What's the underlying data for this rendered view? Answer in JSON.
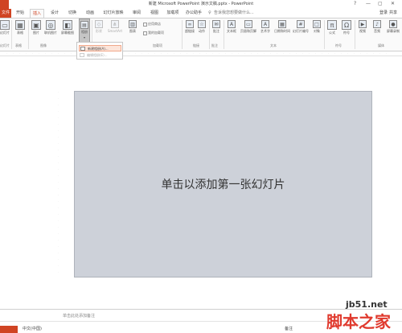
{
  "window": {
    "title": "新建 Microsoft PowerPoint 演示文稿.pptx - PowerPoint",
    "help": "?",
    "minimize": "—",
    "restore": "▢",
    "close": "✕"
  },
  "tabs": [
    {
      "label": "文件"
    },
    {
      "label": "开始"
    },
    {
      "label": "插入"
    },
    {
      "label": "设计"
    },
    {
      "label": "切换"
    },
    {
      "label": "动画"
    },
    {
      "label": "幻灯片放映"
    },
    {
      "label": "审阅"
    },
    {
      "label": "视图"
    },
    {
      "label": "加载项"
    },
    {
      "label": "办公助手"
    },
    {
      "label": "告诉我您想要做什么..."
    }
  ],
  "active_tab": "插入",
  "account": {
    "login": "登录",
    "share": "共享"
  },
  "ribbon": {
    "new_slide": "幻灯片",
    "table": "表格",
    "image": "图片",
    "online_image": "联机图片",
    "screenshot": "屏幕截图",
    "album": "相册",
    "new_slide_btn": "新建幻灯片",
    "shape": "形状",
    "smartart": "SmartArt",
    "chart": "图表",
    "app_store": "应用商店",
    "my_addins": "我的加载项",
    "hyperlink": "超链接",
    "action": "动作",
    "comment": "批注",
    "textbox": "文本框",
    "header_footer": "页眉和页脚",
    "wordart": "艺术字",
    "datetime": "日期和时间",
    "slide_number": "幻灯片编号",
    "object": "对象",
    "equation": "公式",
    "symbol": "符号",
    "video": "视频",
    "audio": "音频",
    "screen_record": "屏幕录制",
    "groups": {
      "slides": "幻灯片",
      "tables": "表格",
      "images": "图像",
      "addins": "加载项",
      "links": "链接",
      "comments": "批注",
      "text": "文本",
      "symbols": "符号",
      "media": "媒体"
    }
  },
  "dropdown": {
    "items": [
      {
        "label": "新建相册(A)..."
      },
      {
        "label": "编辑相册(E)..."
      }
    ]
  },
  "slide": {
    "placeholder": "单击以添加第一张幻灯片"
  },
  "notes": {
    "placeholder": "单击此处添加备注"
  },
  "status": {
    "language": "中文(中国)",
    "notes_btn": "备注"
  },
  "watermark": {
    "url": "jb51.net",
    "name": "脚本之家"
  },
  "colors": {
    "accent": "#d04423",
    "slide_bg": "#cdd1d9"
  }
}
